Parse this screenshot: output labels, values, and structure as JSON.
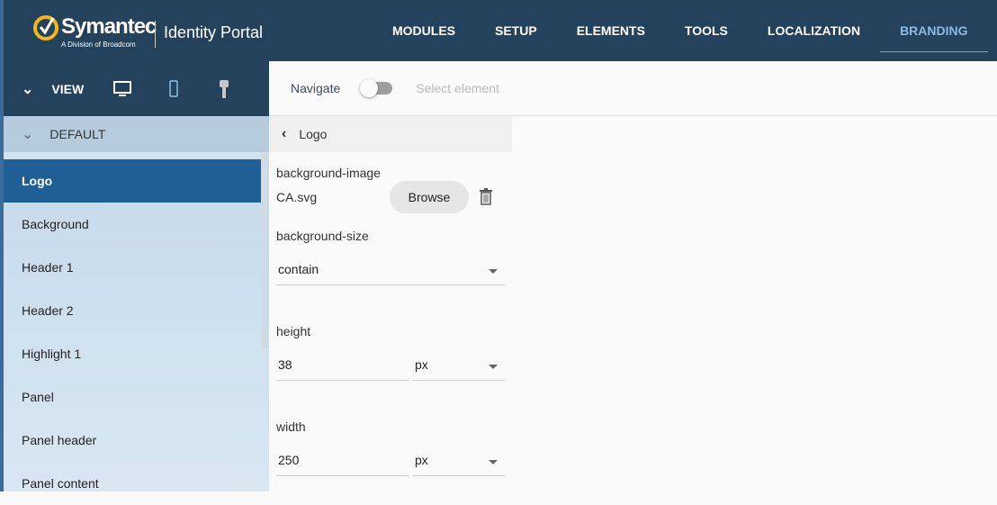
{
  "header": {
    "brand": "Symantec",
    "brand_sub": "A Division of Broadcom",
    "app_title": "Identity Portal",
    "nav": [
      "MODULES",
      "SETUP",
      "ELEMENTS",
      "TOOLS",
      "LOCALIZATION",
      "BRANDING"
    ],
    "active_nav": "BRANDING"
  },
  "view": {
    "label": "VIEW"
  },
  "toolbar": {
    "navigate": "Navigate",
    "select": "Select element",
    "toggle_on": false
  },
  "sidebar": {
    "group": "DEFAULT",
    "items": [
      "Logo",
      "Background",
      "Header 1",
      "Header 2",
      "Highlight 1",
      "Panel",
      "Panel header",
      "Panel content"
    ],
    "selected": "Logo"
  },
  "panel": {
    "title": "Logo",
    "bg_image_label": "background-image",
    "bg_image_value": "CA.svg",
    "browse": "Browse",
    "bg_size_label": "background-size",
    "bg_size_value": "contain",
    "height_label": "height",
    "height_value": "38",
    "height_unit": "px",
    "width_label": "width",
    "width_value": "250",
    "width_unit": "px"
  }
}
